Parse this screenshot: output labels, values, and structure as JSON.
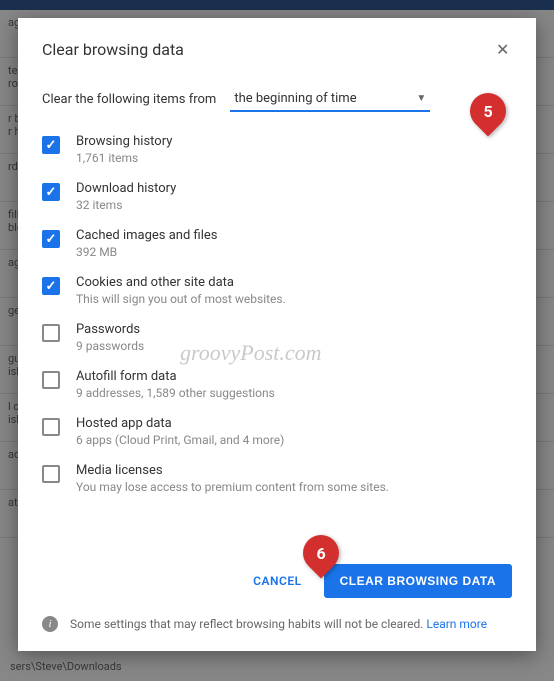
{
  "dialog": {
    "title": "Clear browsing data",
    "time_label": "Clear the following items from",
    "time_value": "the beginning of time"
  },
  "items": [
    {
      "label": "Browsing history",
      "sub": "1,761 items",
      "checked": true
    },
    {
      "label": "Download history",
      "sub": "32 items",
      "checked": true
    },
    {
      "label": "Cached images and files",
      "sub": "392 MB",
      "checked": true
    },
    {
      "label": "Cookies and other site data",
      "sub": "This will sign you out of most websites.",
      "checked": true
    },
    {
      "label": "Passwords",
      "sub": "9 passwords",
      "checked": false
    },
    {
      "label": "Autofill form data",
      "sub": "9 addresses, 1,589 other suggestions",
      "checked": false
    },
    {
      "label": "Hosted app data",
      "sub": "6 apps (Cloud Print, Gmail, and 4 more)",
      "checked": false
    },
    {
      "label": "Media licenses",
      "sub": "You may lose access to premium content from some sites.",
      "checked": false
    }
  ],
  "actions": {
    "cancel": "CANCEL",
    "clear": "CLEAR BROWSING DATA"
  },
  "footer": {
    "text": "Some settings that may reflect browsing habits will not be cleared.",
    "learn_more": "Learn more"
  },
  "badges": {
    "five": "5",
    "six": "6"
  },
  "watermark": "groovyPost.com",
  "bg": {
    "path": "sers\\Steve\\Downloads",
    "rows": [
      "ag",
      "tent\nrol",
      "r bu\nr hi",
      "rds",
      "fill\nble",
      "ag",
      "ges",
      "gua\nish",
      "l ch\nish",
      "ads",
      "atio"
    ]
  }
}
